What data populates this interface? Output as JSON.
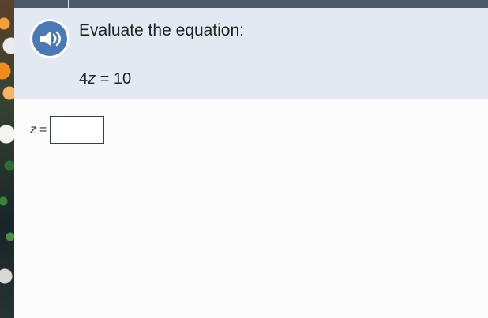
{
  "question": {
    "prompt": "Evaluate the equation:",
    "equation": {
      "coefficient": "4",
      "variable": "z",
      "rest": " = 10"
    }
  },
  "answer": {
    "variable": "z",
    "equals": "=",
    "value": "",
    "placeholder": ""
  },
  "icons": {
    "audio": "speaker-icon"
  },
  "colors": {
    "top_bar": "#4b5a68",
    "question_background": "#e3e9f2",
    "audio_button": "#4b79b6",
    "input_border": "#2f3f55"
  }
}
